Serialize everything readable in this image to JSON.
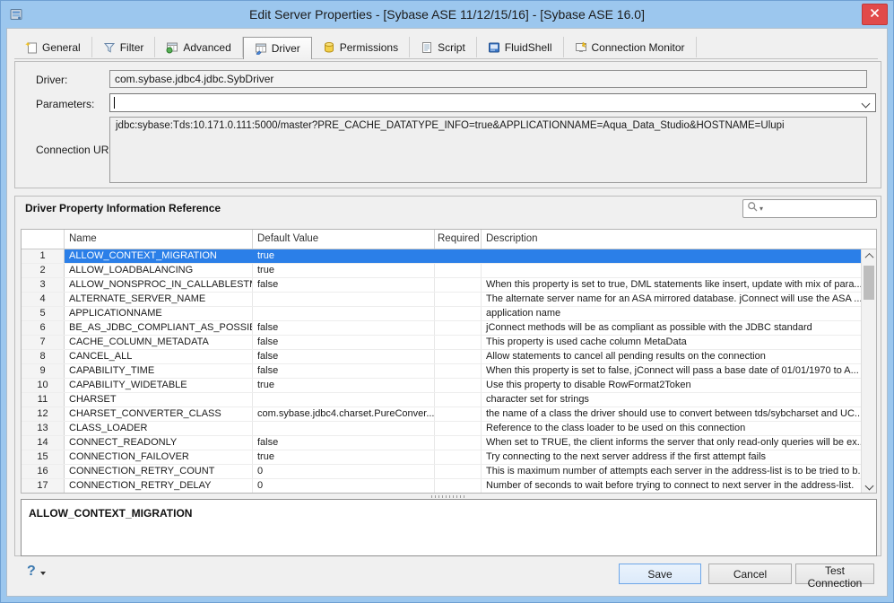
{
  "window": {
    "title": "Edit Server Properties - [Sybase ASE 11/12/15/16] - [Sybase ASE 16.0]"
  },
  "tabs": [
    {
      "label": "General",
      "active": false
    },
    {
      "label": "Filter",
      "active": false
    },
    {
      "label": "Advanced",
      "active": false
    },
    {
      "label": "Driver",
      "active": true
    },
    {
      "label": "Permissions",
      "active": false
    },
    {
      "label": "Script",
      "active": false
    },
    {
      "label": "FluidShell",
      "active": false
    },
    {
      "label": "Connection Monitor",
      "active": false
    }
  ],
  "driver_panel": {
    "driver_label": "Driver:",
    "driver_value": "com.sybase.jdbc4.jdbc.SybDriver",
    "parameters_label": "Parameters:",
    "parameters_value": "",
    "connection_url_label": "Connection URL:",
    "connection_url_value": "jdbc:sybase:Tds:10.171.0.111:5000/master?PRE_CACHE_DATATYPE_INFO=true&APPLICATIONNAME=Aqua_Data_Studio&HOSTNAME=Ulupi"
  },
  "reference_section": {
    "title": "Driver Property Information Reference",
    "search_value": ""
  },
  "property_table": {
    "columns": [
      "",
      "Name",
      "Default Value",
      "Required",
      "Description"
    ],
    "selected_row": 1,
    "rows": [
      {
        "num": "1",
        "name": "ALLOW_CONTEXT_MIGRATION",
        "default": "true",
        "required": "",
        "description": ""
      },
      {
        "num": "2",
        "name": "ALLOW_LOADBALANCING",
        "default": "true",
        "required": "",
        "description": ""
      },
      {
        "num": "3",
        "name": "ALLOW_NONSPROC_IN_CALLABLESTMT",
        "default": "false",
        "required": "",
        "description": "When this property is set to true, DML statements like insert, update with mix of para..."
      },
      {
        "num": "4",
        "name": "ALTERNATE_SERVER_NAME",
        "default": "",
        "required": "",
        "description": "The alternate server name for an ASA mirrored database. jConnect will use the ASA ..."
      },
      {
        "num": "5",
        "name": "APPLICATIONNAME",
        "default": "",
        "required": "",
        "description": "application name"
      },
      {
        "num": "6",
        "name": "BE_AS_JDBC_COMPLIANT_AS_POSSIBLE",
        "default": "false",
        "required": "",
        "description": "jConnect methods will be as compliant as possible with the JDBC standard"
      },
      {
        "num": "7",
        "name": "CACHE_COLUMN_METADATA",
        "default": "false",
        "required": "",
        "description": "This property is used cache column MetaData"
      },
      {
        "num": "8",
        "name": "CANCEL_ALL",
        "default": "false",
        "required": "",
        "description": "Allow statements to cancel all pending results on the connection"
      },
      {
        "num": "9",
        "name": "CAPABILITY_TIME",
        "default": "false",
        "required": "",
        "description": "When this property is set to false, jConnect will pass a base date of 01/01/1970 to A..."
      },
      {
        "num": "10",
        "name": "CAPABILITY_WIDETABLE",
        "default": "true",
        "required": "",
        "description": "Use this property to disable RowFormat2Token"
      },
      {
        "num": "11",
        "name": "CHARSET",
        "default": "",
        "required": "",
        "description": "character set for strings"
      },
      {
        "num": "12",
        "name": "CHARSET_CONVERTER_CLASS",
        "default": "com.sybase.jdbc4.charset.PureConver...",
        "required": "",
        "description": "the name of a class the driver should use to convert between tds/sybcharset and UC..."
      },
      {
        "num": "13",
        "name": "CLASS_LOADER",
        "default": "",
        "required": "",
        "description": "Reference to the class loader to be used on this connection"
      },
      {
        "num": "14",
        "name": "CONNECT_READONLY",
        "default": "false",
        "required": "",
        "description": "When set to TRUE, the client informs the server that only read-only queries will be ex..."
      },
      {
        "num": "15",
        "name": "CONNECTION_FAILOVER",
        "default": "true",
        "required": "",
        "description": "Try connecting to the next server address if the first attempt fails"
      },
      {
        "num": "16",
        "name": "CONNECTION_RETRY_COUNT",
        "default": "0",
        "required": "",
        "description": "This is maximum number of attempts each server in the address-list is to be tried to b..."
      },
      {
        "num": "17",
        "name": "CONNECTION_RETRY_DELAY",
        "default": "0",
        "required": "",
        "description": "Number of seconds to wait before trying to connect to next server in the address-list."
      }
    ]
  },
  "detail_panel": {
    "text": "ALLOW_CONTEXT_MIGRATION"
  },
  "footer": {
    "help_label": "?",
    "save_label": "Save",
    "cancel_label": "Cancel",
    "test_connection_label": "Test Connection"
  },
  "colors": {
    "titlebar_blue": "#9cc7ee",
    "selection_blue": "#2b7fe8",
    "close_red": "#e14a4a",
    "save_accent": "#6da6e8"
  }
}
